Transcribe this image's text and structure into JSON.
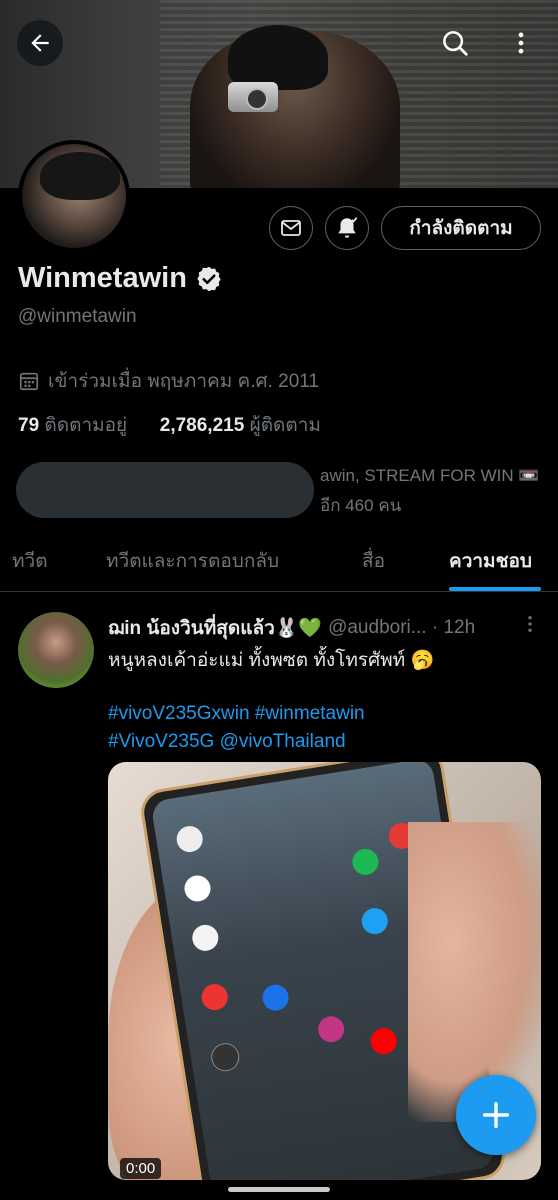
{
  "profile": {
    "display_name": "Winmetawin",
    "handle": "@winmetawin",
    "joined": "เข้าร่วมเมื่อ พฤษภาคม ค.ศ. 2011",
    "following_count": "79",
    "following_label": "ติดตามอยู่",
    "followers_count": "2,786,215",
    "followers_label": "ผู้ติดตาม",
    "follow_button": "กำลังติดตาม",
    "known_followers_line1": "awin, STREAM FOR WIN 📼",
    "known_followers_line2": "อีก 460 คน"
  },
  "tabs": [
    {
      "label": "ทวีต"
    },
    {
      "label": "ทวีตและการตอบกลับ"
    },
    {
      "label": "สื่อ"
    },
    {
      "label": "ความชอบ"
    }
  ],
  "active_tab": "ความชอบ",
  "tweet": {
    "display_name": "ฌin น้องวินที่สุดแล้ว🐰💚",
    "meta": "@audbori... · 12h",
    "text": "หนูหลงเค้าอ่ะแม่ ทั้งพซต ทั้งโทรศัพท์ 🥱",
    "tags_line1": "#vivoV235Gxwin #winmetawin",
    "tags_line2": "#VivoV235G @vivoThailand",
    "video_duration": "0:00"
  },
  "icons": {
    "back": "arrow-left-icon",
    "search": "search-icon",
    "more": "more-vertical-icon",
    "message": "envelope-icon",
    "notify": "bell-check-icon",
    "verified": "verified-badge-icon",
    "calendar": "calendar-icon",
    "compose": "plus-icon"
  },
  "colors": {
    "accent": "#1d9bf0",
    "background": "#000000",
    "secondary_text": "#71767b"
  }
}
